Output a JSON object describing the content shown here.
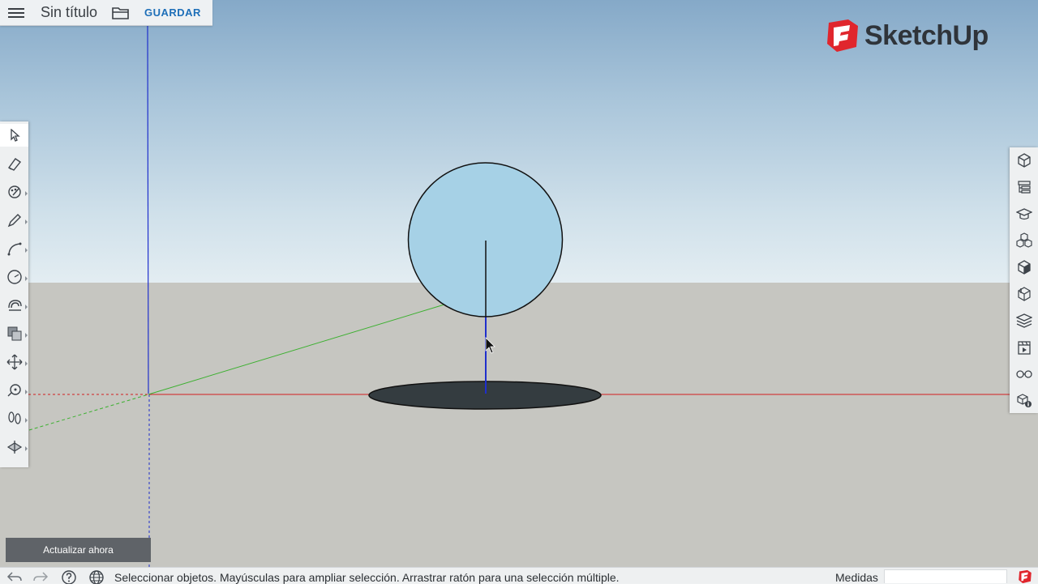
{
  "app": {
    "brand": "SketchUp",
    "brand_color": "#e0262d"
  },
  "topbar": {
    "title": "Sin título",
    "save_label": "GUARDAR",
    "icons": [
      "menu-icon",
      "folder-icon"
    ]
  },
  "left_toolbar": {
    "tools": [
      {
        "name": "select-tool",
        "icon": "arrow-cursor-icon",
        "active": true
      },
      {
        "name": "eraser-tool",
        "icon": "eraser-icon"
      },
      {
        "name": "paint-tool",
        "icon": "paint-palette-icon"
      },
      {
        "name": "line-tool",
        "icon": "pencil-icon"
      },
      {
        "name": "arc-tool",
        "icon": "arc-icon"
      },
      {
        "name": "circle-tool",
        "icon": "circle-icon"
      },
      {
        "name": "pushpull-tool",
        "icon": "pushpull-icon"
      },
      {
        "name": "offset-tool",
        "icon": "offset-icon"
      },
      {
        "name": "move-tool",
        "icon": "move-arrows-icon"
      },
      {
        "name": "tape-measure-tool",
        "icon": "tape-measure-icon"
      },
      {
        "name": "walk-tool",
        "icon": "footprints-icon"
      },
      {
        "name": "section-tool",
        "icon": "section-plane-icon"
      }
    ]
  },
  "right_toolbar": {
    "panels": [
      {
        "name": "entity-info-panel",
        "icon": "entity-info-icon"
      },
      {
        "name": "outliner-panel",
        "icon": "outliner-icon"
      },
      {
        "name": "instructor-panel",
        "icon": "graduation-cap-icon"
      },
      {
        "name": "components-panel",
        "icon": "components-icon"
      },
      {
        "name": "materials-panel",
        "icon": "materials-cube-icon"
      },
      {
        "name": "styles-panel",
        "icon": "styles-icon"
      },
      {
        "name": "layers-panel",
        "icon": "layers-icon"
      },
      {
        "name": "scenes-panel",
        "icon": "scenes-clapper-icon"
      },
      {
        "name": "display-panel",
        "icon": "glasses-icon"
      },
      {
        "name": "model-info-panel",
        "icon": "model-info-icon"
      }
    ]
  },
  "update_button": {
    "label": "Actualizar ahora"
  },
  "statusbar": {
    "hint": "Seleccionar objetos. Mayúsculas para ampliar selección. Arrastrar ratón para una selección múltiple.",
    "measurements_label": "Medidas",
    "measurements_value": "",
    "icons": [
      "undo-icon",
      "redo-icon",
      "help-icon",
      "globe-icon"
    ]
  },
  "scene_colors": {
    "red_axis": "#d21f1f",
    "green_axis": "#3cb030",
    "blue_axis": "#1f2fcc",
    "circle_fill": "#a6d1e6",
    "disc_fill": "#343c40"
  }
}
